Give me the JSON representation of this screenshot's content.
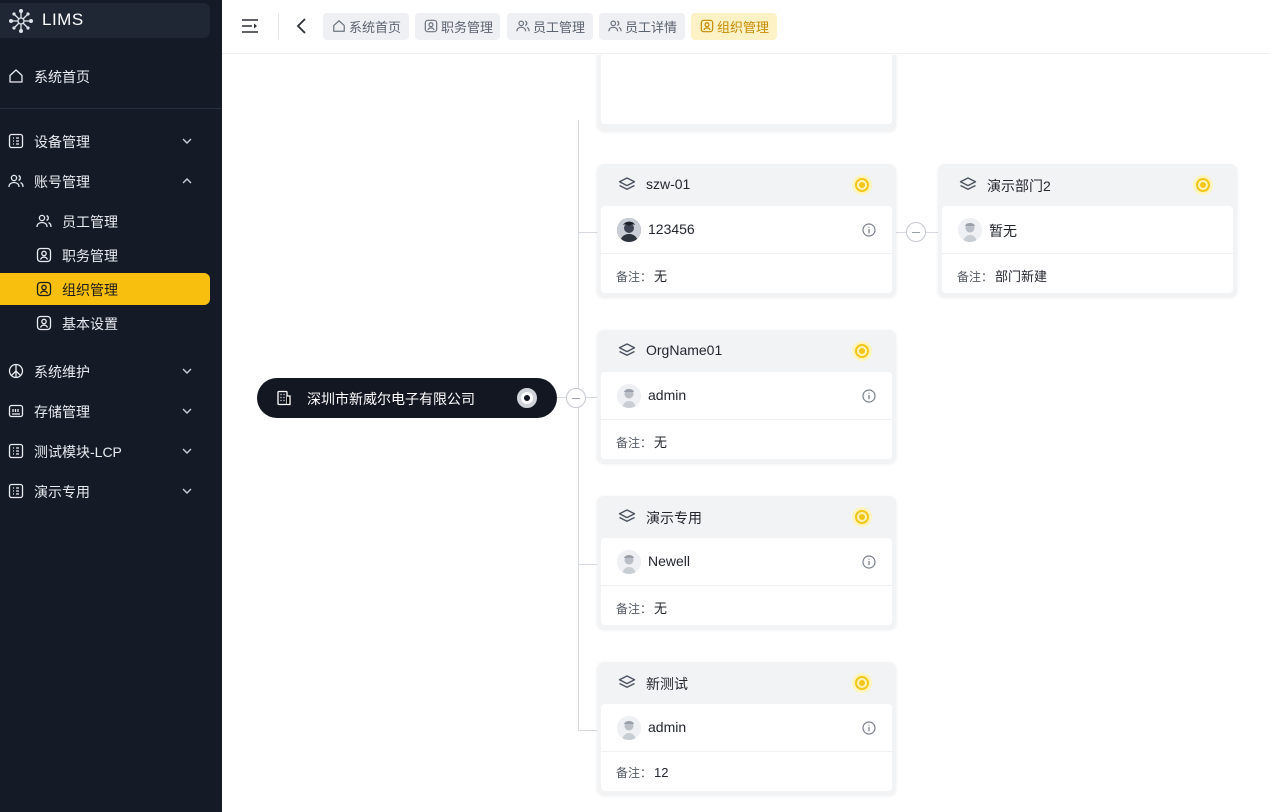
{
  "app": {
    "title": "LIMS"
  },
  "sidebar": {
    "home": "系统首页",
    "groups": [
      {
        "label": "设备管理",
        "icon": "grid-icon",
        "expanded": false
      },
      {
        "label": "账号管理",
        "icon": "users-icon",
        "expanded": true
      },
      {
        "label": "系统维护",
        "icon": "peace-icon",
        "expanded": false
      },
      {
        "label": "存储管理",
        "icon": "storage-icon",
        "expanded": false
      },
      {
        "label": "测试模块-LCP",
        "icon": "grid-icon",
        "expanded": false
      },
      {
        "label": "演示专用",
        "icon": "grid-icon",
        "expanded": false
      }
    ],
    "account_items": [
      {
        "label": "员工管理",
        "icon": "users-icon"
      },
      {
        "label": "职务管理",
        "icon": "id-badge-icon"
      },
      {
        "label": "组织管理",
        "icon": "id-badge-icon",
        "active": true
      },
      {
        "label": "基本设置",
        "icon": "id-badge-icon"
      }
    ]
  },
  "tabs": [
    {
      "label": "系统首页",
      "icon": "home-icon"
    },
    {
      "label": "职务管理",
      "icon": "id-badge-icon"
    },
    {
      "label": "员工管理",
      "icon": "users-icon"
    },
    {
      "label": "员工详情",
      "icon": "users-icon"
    },
    {
      "label": "组织管理",
      "icon": "id-badge-icon",
      "active": true
    }
  ],
  "org": {
    "root": "深圳市新威尔电子有限公司",
    "remark_label": "备注：",
    "departments": [
      {
        "name": "szw-01",
        "person": "123456",
        "remark": "无",
        "avatar": "photo"
      },
      {
        "name": "OrgName01",
        "person": "admin",
        "remark": "无",
        "avatar": "default"
      },
      {
        "name": "演示专用",
        "person": "Newell",
        "remark": "无",
        "avatar": "default"
      },
      {
        "name": "新测试",
        "person": "admin",
        "remark": "12",
        "avatar": "default"
      }
    ],
    "sub_departments": [
      {
        "name": "演示部门2",
        "person": "暂无",
        "remark": "部门新建",
        "avatar": "default"
      }
    ]
  },
  "colors": {
    "sidebar_bg": "#141a26",
    "accent": "#f9bf0f",
    "root_bg": "#131722"
  }
}
